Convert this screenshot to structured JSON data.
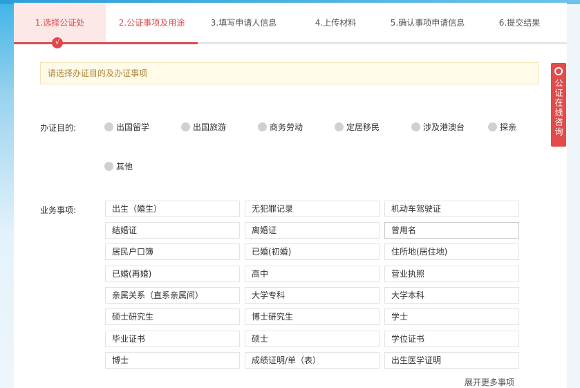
{
  "steps": [
    {
      "label": "1.选择公证处",
      "state": "active"
    },
    {
      "label": "2.公证事项及用途",
      "state": "done"
    },
    {
      "label": "3.填写申请人信息",
      "state": "pending"
    },
    {
      "label": "4.上传材料",
      "state": "pending"
    },
    {
      "label": "5.确认事项申请信息",
      "state": "pending"
    },
    {
      "label": "6.提交结果",
      "state": "pending"
    }
  ],
  "check_icon": "√",
  "notice": "请选择办证目的及办证事项",
  "purpose": {
    "label": "办证目的:",
    "options": [
      "出国留学",
      "出国旅游",
      "商务劳动",
      "定居移民",
      "涉及港澳台",
      "探亲",
      "其他"
    ]
  },
  "business": {
    "label": "业务事项:",
    "items": [
      "出生（婚生）",
      "无犯罪记录",
      "机动车驾驶证",
      "结婚证",
      "离婚证",
      "曾用名",
      "居民户口簿",
      "已婚(初婚)",
      "住所地(居住地)",
      "已婚(再婚)",
      "高中",
      "营业执照",
      "亲属关系（直系亲属间）",
      "大学专科",
      "大学本科",
      "硕士研究生",
      "博士研究生",
      "学士",
      "毕业证书",
      "硕士",
      "学位证书",
      "博士",
      "成绩证明/单（表）",
      "出生医学证明"
    ],
    "more": "展开更多事项"
  },
  "consult": {
    "label": "公证在线咨询",
    "icon": "headset-icon"
  },
  "colors": {
    "accent": "#e0484e",
    "notice_bg": "#fffbe8",
    "notice_text": "#b2843a"
  }
}
